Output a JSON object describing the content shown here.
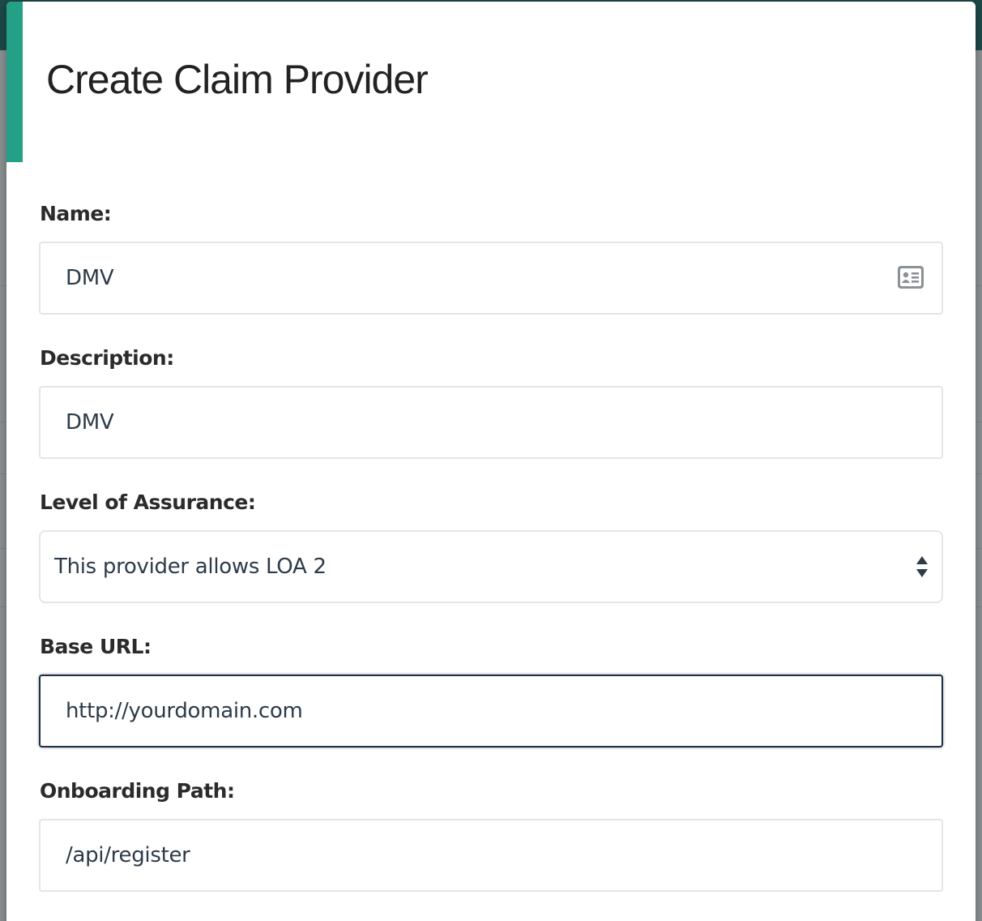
{
  "modal": {
    "title": "Create Claim Provider"
  },
  "fields": {
    "name": {
      "label": "Name:",
      "value": "DMV",
      "icon": "contact-card-icon"
    },
    "description": {
      "label": "Description:",
      "value": "DMV"
    },
    "level_of_assurance": {
      "label": "Level of Assurance:",
      "selected": "This provider allows LOA 2",
      "icon": "select-arrows-icon"
    },
    "base_url": {
      "label": "Base URL:",
      "value": "http://yourdomain.com"
    },
    "onboarding_path": {
      "label": "Onboarding Path:",
      "value": "/api/register"
    }
  },
  "colors": {
    "accent": "#23a085",
    "focus_border": "#1f2f44",
    "input_border": "#e3e6e8",
    "text": "#2d3b49"
  }
}
